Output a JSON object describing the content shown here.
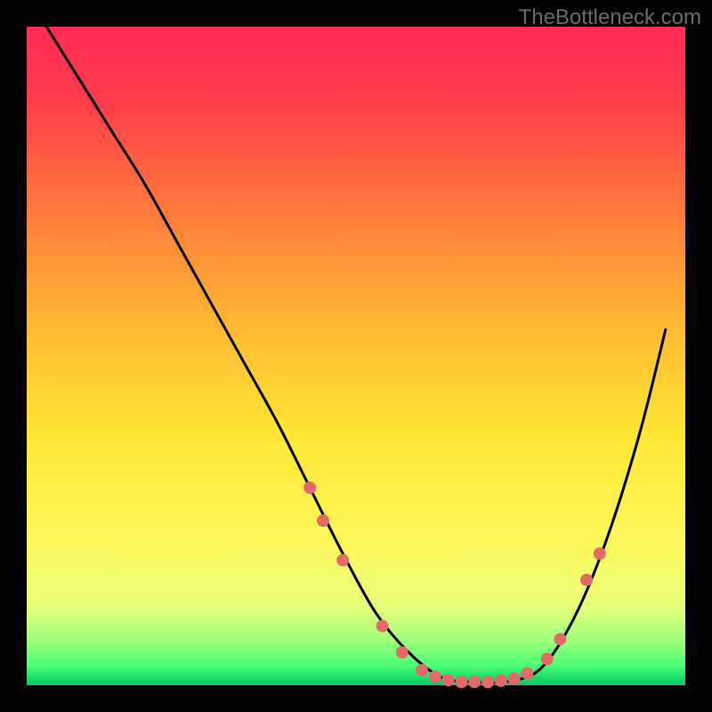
{
  "watermark": "TheBottleneck.com",
  "chart_data": {
    "type": "line",
    "title": "",
    "xlabel": "",
    "ylabel": "",
    "xlim": [
      0,
      100
    ],
    "ylim": [
      0,
      100
    ],
    "background_gradient": [
      "#ff2a55",
      "#ff5a3c",
      "#ffb733",
      "#ffe733",
      "#fff85a",
      "#d6ff6a",
      "#5cff7a",
      "#00d66b"
    ],
    "series": [
      {
        "name": "curve",
        "x": [
          3,
          8,
          13,
          18,
          23,
          28,
          33,
          38,
          43,
          48,
          53,
          58,
          63,
          68,
          73,
          78,
          83,
          88,
          93,
          97
        ],
        "values": [
          100,
          92,
          84,
          76,
          67,
          58,
          49,
          40,
          30,
          20,
          11,
          5,
          1.2,
          0.5,
          0.6,
          2.5,
          10,
          22,
          38,
          54
        ],
        "color": "#000000"
      }
    ],
    "markers": {
      "name": "highlight-dots",
      "color": "#e46a6a",
      "points": [
        {
          "x": 43,
          "y": 30
        },
        {
          "x": 45,
          "y": 25
        },
        {
          "x": 48,
          "y": 19
        },
        {
          "x": 54,
          "y": 9
        },
        {
          "x": 57,
          "y": 5
        },
        {
          "x": 60,
          "y": 2.3
        },
        {
          "x": 62,
          "y": 1.3
        },
        {
          "x": 64,
          "y": 0.8
        },
        {
          "x": 66,
          "y": 0.5
        },
        {
          "x": 68,
          "y": 0.5
        },
        {
          "x": 70,
          "y": 0.5
        },
        {
          "x": 72,
          "y": 0.7
        },
        {
          "x": 74,
          "y": 1.0
        },
        {
          "x": 76,
          "y": 1.8
        },
        {
          "x": 79,
          "y": 4
        },
        {
          "x": 81,
          "y": 7
        },
        {
          "x": 85,
          "y": 16
        },
        {
          "x": 87,
          "y": 20
        }
      ]
    }
  }
}
